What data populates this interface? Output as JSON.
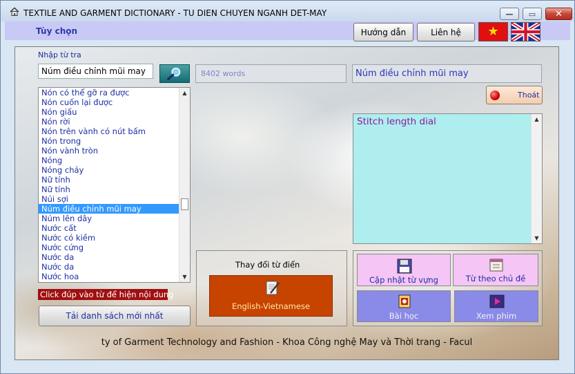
{
  "window": {
    "title": "TEXTILE AND GARMENT DICTIONARY - TU DIEN CHUYEN NGANH DET-MAY",
    "minimize_glyph": "—",
    "maximize_glyph": "▭",
    "close_glyph": "✕"
  },
  "menubar": {
    "options_label": "Tùy chọn"
  },
  "toolbar": {
    "guide_label": "Hướng dẫn",
    "contact_label": "Liên hệ",
    "flags": [
      "vietnam-flag",
      "uk-flag"
    ]
  },
  "search": {
    "label": "Nhập từ tra",
    "value": "Núm điều chỉnh mũi may",
    "word_count": "8402 words",
    "selected_word": "Núm điều chỉnh mũi may"
  },
  "wordlist": {
    "items": [
      "Nón có thể gỡ ra được",
      "Nón cuốn lại được",
      "Nón giấu",
      "Nón rời",
      "Nón trên vành có nút bấm",
      "Nón trong",
      "Nón vành tròn",
      "Nóng",
      "Nóng chảy",
      "Nữ tính",
      "Nữ tính",
      "Núi sợi",
      "Núm điều chỉnh mũi may",
      "Núm lên dây",
      "Nước cất",
      "Nước có kiềm",
      "Nước cứng",
      "Nước da",
      "Nước da",
      "Nước hoa"
    ],
    "selected_index": 12,
    "scroll_position": 0.62
  },
  "hint_text": "Click đúp vào từ để hiện nội dung",
  "reload_label": "Tải danh sách mới nhất",
  "exit_label": "Thoát",
  "meaning": {
    "text": "Stitch length dial"
  },
  "dictionary": {
    "change_label": "Thay đổi từ điển",
    "current": "English-Vietnamese"
  },
  "tiles": {
    "update_vocab": "Cập nhật từ vựng",
    "by_topic": "Từ theo chủ đề",
    "lessons": "Bài học",
    "watch_movies": "Xem phim"
  },
  "footer_text": "ty of Garment Technology and Fashion - Khoa Công nghệ May và Thời trang - Facul",
  "colors": {
    "menubar": "#c9c9f6",
    "meaning_bg": "#aeeeee",
    "dict_button": "#c74300",
    "tile_pink": "#f5c5f5",
    "tile_purple": "#8a8ae8",
    "hint_bg": "#a01010",
    "selection": "#3399ff"
  }
}
